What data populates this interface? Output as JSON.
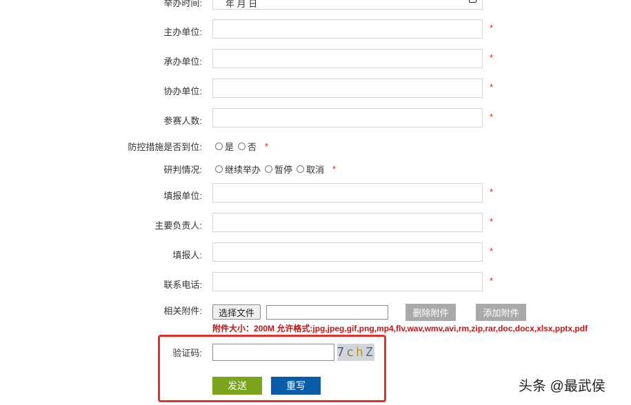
{
  "form": {
    "date_row": {
      "label": "举办时间:",
      "value": "年 月 日"
    },
    "organizer": {
      "label": "主办单位:",
      "required_mark": "*"
    },
    "undertaker": {
      "label": "承办单位:",
      "required_mark": "*"
    },
    "co_organizer": {
      "label": "协办单位:",
      "required_mark": "*"
    },
    "participants": {
      "label": "参赛人数:",
      "required_mark": "*"
    },
    "prevention": {
      "label": "防控措施是否到位:",
      "options": [
        "是",
        "否"
      ],
      "required_mark": "*"
    },
    "judgement": {
      "label": "研判情况:",
      "options": [
        "继续举办",
        "暂停",
        "取消"
      ],
      "required_mark": "*"
    },
    "reporting_unit": {
      "label": "填报单位:",
      "required_mark": "*"
    },
    "principal": {
      "label": "主要负责人:",
      "required_mark": "*"
    },
    "reporter": {
      "label": "填报人:",
      "required_mark": "*"
    },
    "phone": {
      "label": "联系电话:",
      "required_mark": "*"
    },
    "attachment": {
      "label": "相关附件:",
      "choose_file": "选择文件",
      "delete": "删除附件",
      "add": "添加附件",
      "hint": "附件大小：200M 允许格式:jpg,jpeg,gif,png,mp4,flv,wav,wmv,avi,rm,zip,rar,doc,docx,xlsx,pptx,pdf"
    },
    "captcha": {
      "label": "验证码:",
      "image_text": [
        "7",
        "c",
        "h",
        "Z"
      ]
    },
    "buttons": {
      "submit": "发送",
      "reset": "重写"
    }
  },
  "watermark": "头条 @最武侯",
  "colors": {
    "required": "#e02020",
    "submit_bg": "#7aa51b",
    "reset_bg": "#0a5ba8",
    "highlight_border": "#e3302f",
    "gray_button": "#a9a9a9"
  }
}
